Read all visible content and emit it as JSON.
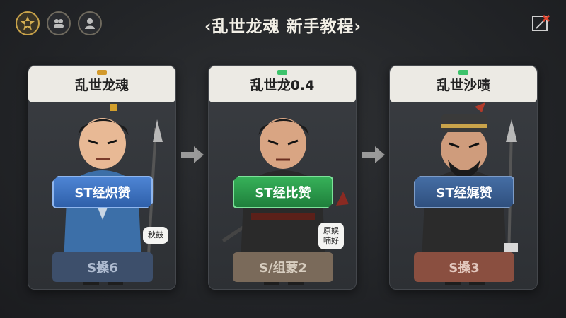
{
  "header": {
    "title": "‹乱世龙魂 新手教程›"
  },
  "icons": {
    "top_left": [
      "emblem-icon",
      "group-icon",
      "profile-icon"
    ],
    "close": "close-icon"
  },
  "colors": {
    "accent_gold": "#c9a34a",
    "blue": "#4f86d6",
    "green": "#37b35a"
  },
  "cards": [
    {
      "title": "乱世龙魂",
      "flag_color": "#d39a2c",
      "stat_label": "ST经炽赞",
      "bubble": "秋鼓",
      "sub_label": "S搡6"
    },
    {
      "title": "乱世龙0.4",
      "flag_color": "#3cc36b",
      "stat_label": "ST经比赞",
      "bubble": "原娱\n喃好",
      "sub_label": "S/组蒙2"
    },
    {
      "title": "乱世沙啧",
      "flag_color": "#3cc36b",
      "stat_label": "ST经娓赞",
      "bubble": "",
      "sub_label": "S搡3"
    }
  ]
}
